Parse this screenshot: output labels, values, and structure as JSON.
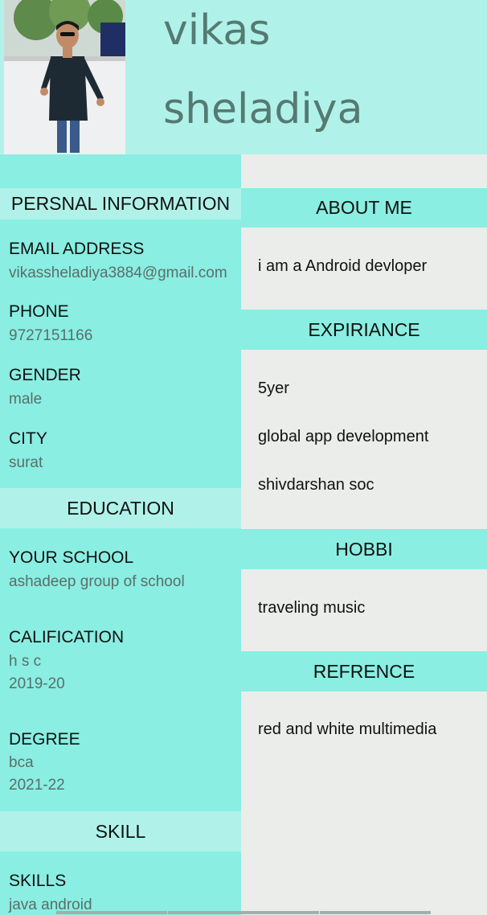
{
  "header": {
    "first_name": "vikas",
    "last_name": "sheladiya"
  },
  "personal": {
    "title": "PERSNAL INFORMATION",
    "email_label": "EMAIL ADDRESS",
    "email_value": "vikassheladiya3884@gmail.com",
    "phone_label": "PHONE",
    "phone_value": "9727151166",
    "gender_label": "GENDER",
    "gender_value": "male",
    "city_label": "CITY",
    "city_value": "surat"
  },
  "education": {
    "title": "EDUCATION",
    "school_label": "YOUR SCHOOL",
    "school_value": "ashadeep group of school",
    "calification_label": "CALIFICATION",
    "calification_value": "h s c",
    "calification_year": "2019-20",
    "degree_label": "DEGREE",
    "degree_value": "bca",
    "degree_year": "2021-22"
  },
  "skill": {
    "title": "SKILL",
    "skills_label": "SKILLS",
    "skills_value": "java android"
  },
  "about": {
    "title": "ABOUT ME",
    "text": "i am a Android devloper"
  },
  "experience": {
    "title": "EXPIRIANCE",
    "years": "5yer",
    "company": "global app development",
    "address": "shivdarshan soc"
  },
  "hobby": {
    "title": "HOBBI",
    "text": "traveling music"
  },
  "reference": {
    "title": "REFRENCE",
    "text": "red and white multimedia"
  },
  "colors": {
    "header_bg": "#b0f2e9",
    "panel_teal": "#8aeee2",
    "panel_gray": "#ebedeb",
    "name_color": "#557a71"
  }
}
